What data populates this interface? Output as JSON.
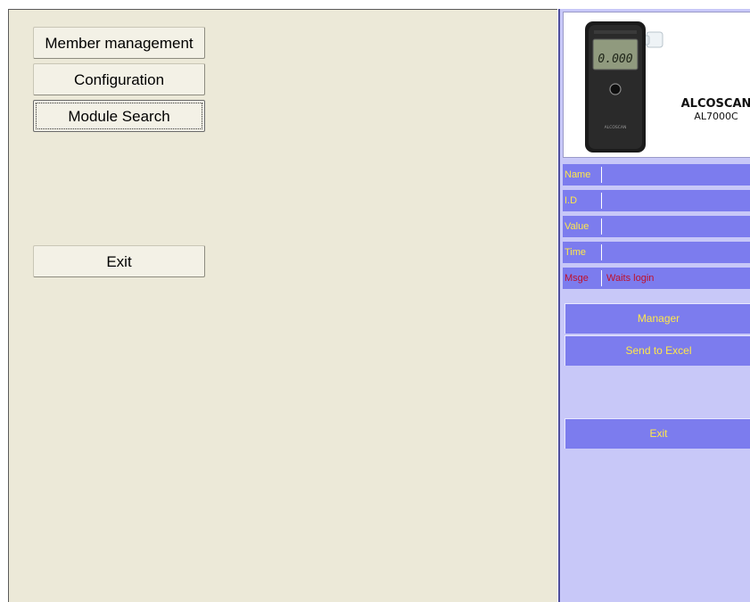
{
  "left_panel": {
    "buttons": {
      "member_management": "Member management",
      "configuration": "Configuration",
      "module_search": "Module Search",
      "exit": "Exit"
    }
  },
  "device": {
    "brand": "ALCOSCAN",
    "model": "AL7000C",
    "display_reading": "0.000",
    "body_brand": "ALCOSCAN"
  },
  "info": {
    "rows": [
      {
        "label": "Name",
        "value": ""
      },
      {
        "label": "I.D",
        "value": ""
      },
      {
        "label": "Value",
        "value": ""
      },
      {
        "label": "Time",
        "value": ""
      },
      {
        "label": "Msge",
        "value": "Waits login"
      }
    ]
  },
  "right_panel": {
    "buttons": {
      "manager": "Manager",
      "send_to_excel": "Send to Excel",
      "exit": "Exit"
    }
  },
  "colors": {
    "left_background": "#ece9d8",
    "right_background": "#c8c8f8",
    "panel_button": "#7c7cee",
    "label_text": "#ffe84a",
    "message_text": "#c0102a"
  }
}
